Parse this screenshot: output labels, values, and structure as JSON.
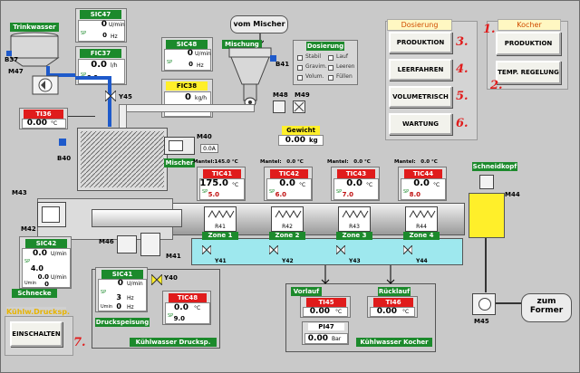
{
  "trinkwasser": {
    "label": "Trinkwasser",
    "b37": "B37",
    "m47": "M47"
  },
  "sic47": {
    "tag": "SIC47",
    "value": "0",
    "unit": "U/min",
    "sp": "SP",
    "sp_value": "0",
    "sp_unit": "Hz"
  },
  "fic37": {
    "tag": "FIC37",
    "value": "0.0",
    "unit": "l/h",
    "sp": "SP",
    "sp_value": "6.0"
  },
  "y45": "Y45",
  "ti36": {
    "tag": "TI36",
    "value": "0.00",
    "unit": "°C"
  },
  "vom_mischer": "vom Mischer",
  "mischung": "Mischung",
  "b41": "B41",
  "sic48": {
    "tag": "SIC48",
    "value": "0",
    "unit": "U/min",
    "sp": "SP",
    "sp_value": "0",
    "sp_unit": "Hz"
  },
  "fic38": {
    "tag": "FIC38",
    "value": "0",
    "unit": "kg/h",
    "sp": "SP",
    "sp_value": "1.2"
  },
  "m48": "M48",
  "m49": "M49",
  "dosierung_box": {
    "title": "Dosierung",
    "items": [
      "Stabil",
      "Lauf",
      "Gravim.",
      "Leeren",
      "Volum.",
      "Füllen"
    ]
  },
  "gewicht": {
    "label": "Gewicht",
    "value": "0.00",
    "unit": "kg"
  },
  "m40": "M40",
  "m40_value": "0.0A",
  "mischer_label": "Mischer",
  "b40": "B40",
  "m43": "M43",
  "m42": "M42",
  "m46": "M46",
  "m41": "M41",
  "sic42": {
    "tag": "SIC42",
    "value": "0.0",
    "unit": "U/min",
    "sp": "SP",
    "sp_value": "4.0",
    "sp_extra": "0.0",
    "sp_unit": "U/min",
    "umin": "Umin",
    "umin_value": "0"
  },
  "schnecke": "Schnecke",
  "sic41": {
    "tag": "SIC41",
    "value": "0",
    "unit": "U/min",
    "sp": "SP",
    "sp_value": "3",
    "sp_unit": "Hz",
    "umin": "Umin",
    "umin_value": "0",
    "umin_unit": "Hz"
  },
  "y40": "Y40",
  "druckspeisung": "Druckspeisung",
  "tic48": {
    "tag": "TIC48",
    "value": "0.0",
    "unit": "°C",
    "sp": "SP",
    "sp_value": "9.0"
  },
  "kuehlwasser_druck": "Kühlwasser Drucksp.",
  "kuehlw_druck_header": "Kühlw.Drucksp.",
  "einschalten": "EINSCHALTEN",
  "zones": [
    {
      "mantel": "Mantel:145.0 °C",
      "tag": "TIC41",
      "value": "175.0",
      "unit": "°C",
      "sp": "SP",
      "sp_value": "5.0",
      "r": "R41",
      "zone": "Zone 1",
      "y": "Y41"
    },
    {
      "mantel": "Mantel:   0.0 °C",
      "tag": "TIC42",
      "value": "0.0",
      "unit": "°C",
      "sp": "SP",
      "sp_value": "6.0",
      "r": "R42",
      "zone": "Zone 2",
      "y": "Y42"
    },
    {
      "mantel": "Mantel:   0.0 °C",
      "tag": "TIC43",
      "value": "0.0",
      "unit": "°C",
      "sp": "SP",
      "sp_value": "7.0",
      "r": "R43",
      "zone": "Zone 3",
      "y": "Y43"
    },
    {
      "mantel": "Mantel:   0.0 °C",
      "tag": "TIC44",
      "value": "0.0",
      "unit": "°C",
      "sp": "SP",
      "sp_value": "8.0",
      "r": "R44",
      "zone": "Zone 4",
      "y": "Y44"
    }
  ],
  "schneidkopf": "Schneidkopf",
  "m44": "M44",
  "m45": "M45",
  "zum_former": {
    "line1": "zum",
    "line2": "Former"
  },
  "vorlauf": "Vorlauf",
  "ruecklauf": "Rücklauf",
  "ti45": {
    "tag": "TI45",
    "value": "0.00",
    "unit": "°C"
  },
  "ti46": {
    "tag": "TI46",
    "value": "0.00",
    "unit": "°C"
  },
  "pi47": {
    "tag": "PI47",
    "value": "0.00",
    "unit": "Bar"
  },
  "kuehlwasser_kocher": "Kühlwasser Kocher",
  "dosierung_panel": {
    "header": "Dosierung",
    "buttons": [
      "PRODUKTION",
      "LEERFAHREN",
      "VOLUMETRISCH",
      "WARTUNG"
    ],
    "numbers": [
      "3.",
      "4.",
      "5.",
      "6."
    ]
  },
  "kocher_panel": {
    "header": "Kocher",
    "buttons": [
      "PRODUKTION",
      "TEMP. REGELUNG"
    ],
    "numbers": [
      "1.",
      "2."
    ]
  },
  "einschalten_number": "7.",
  "colors": {
    "background": "#c9c9c9",
    "green": "#1c8a2c",
    "red": "#e01c1c",
    "yellow": "#ffef2a",
    "water": "#9ee8ee",
    "pipe": "#1e5acb"
  }
}
